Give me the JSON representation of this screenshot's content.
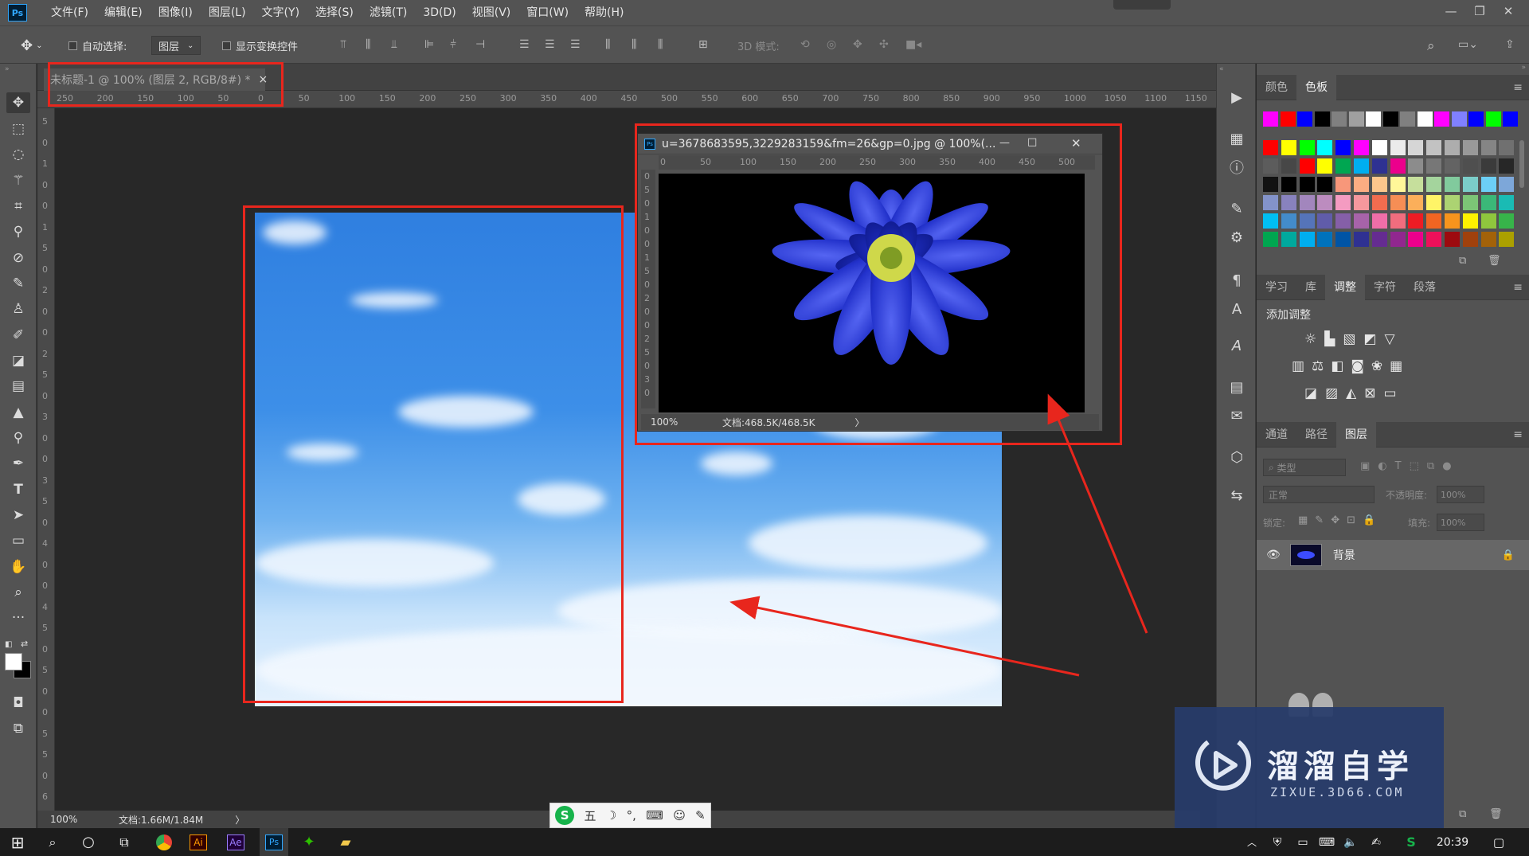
{
  "app": {
    "logo": "Ps"
  },
  "menu": [
    "文件(F)",
    "编辑(E)",
    "图像(I)",
    "图层(L)",
    "文字(Y)",
    "选择(S)",
    "滤镜(T)",
    "3D(D)",
    "视图(V)",
    "窗口(W)",
    "帮助(H)"
  ],
  "window_controls": {
    "minimize": "—",
    "restore": "❐",
    "close": "✕"
  },
  "options": {
    "auto_select_label": "自动选择:",
    "auto_select_value": "图层",
    "transform_label": "显示变换控件",
    "mode3d_label": "3D 模式:"
  },
  "tools": [
    "move-tool",
    "marquee-tool",
    "lasso-tool",
    "magic-wand-tool",
    "crop-tool",
    "eyedropper-tool",
    "healing-brush-tool",
    "brush-tool",
    "clone-stamp-tool",
    "history-brush-tool",
    "eraser-tool",
    "gradient-tool",
    "blur-tool",
    "dodge-tool",
    "pen-tool",
    "type-tool",
    "path-selection-tool",
    "rectangle-tool",
    "hand-tool",
    "zoom-tool",
    "more-tools"
  ],
  "document": {
    "tab_title": "未标题-1 @ 100% (图层 2, RGB/8#) *",
    "tab_close": "×",
    "ruler_h": [
      "250",
      "200",
      "150",
      "100",
      "50",
      "0",
      "50",
      "100",
      "150",
      "200",
      "250",
      "300",
      "350",
      "400",
      "450",
      "500",
      "550",
      "600",
      "650",
      "700",
      "750",
      "800",
      "850",
      "900",
      "950",
      "1000",
      "1050",
      "1100",
      "1150"
    ],
    "ruler_v": [
      "5",
      "0",
      "1",
      "0",
      "0",
      "1",
      "5",
      "0",
      "2",
      "0",
      "0",
      "2",
      "5",
      "0",
      "3",
      "0",
      "0",
      "3",
      "5",
      "0",
      "4",
      "0",
      "0",
      "4",
      "5",
      "0",
      "5",
      "0",
      "0",
      "5",
      "5",
      "0",
      "6"
    ]
  },
  "float_window": {
    "title": "u=3678683595,3229283159&fm=26&gp=0.jpg @ 100%(...",
    "controls": {
      "minimize": "—",
      "maximize": "□",
      "close": "✕"
    },
    "ruler_h": [
      "0",
      "50",
      "100",
      "150",
      "200",
      "250",
      "300",
      "350",
      "400",
      "450",
      "500"
    ],
    "ruler_v": [
      "0",
      "5",
      "0",
      "1",
      "0",
      "0",
      "1",
      "5",
      "0",
      "2",
      "0",
      "0",
      "2",
      "5",
      "0",
      "3",
      "0"
    ],
    "zoom": "100%",
    "doc_info": "文档:468.5K/468.5K",
    "arrow": "〉"
  },
  "panels": {
    "color_tabs": [
      "颜色",
      "色板"
    ],
    "swatches_top": [
      "#ff00ff",
      "#ff0000",
      "#0000ff",
      "#000000",
      "#808080",
      "#a0a0a0",
      "#ffffff",
      "#000000",
      "#808080",
      "#ffffff",
      "#ff00ff",
      "#8080ff",
      "#0000ff",
      "#00ff00",
      "#0000ff"
    ],
    "swatch_grid": [
      [
        "#ff0000",
        "#ffff00",
        "#00ff00",
        "#00ffff",
        "#0000ff",
        "#ff00ff",
        "#ffffff",
        "#ebebeb",
        "#d6d6d6",
        "#c2c2c2",
        "#adadad",
        "#999999",
        "#858585",
        "#707070"
      ],
      [
        "#5c5c5c",
        "#474747",
        "#ff0000",
        "#ffff00",
        "#00a651",
        "#00aeef",
        "#2e3192",
        "#ec008c",
        "#8c8c8c",
        "#777777",
        "#636363",
        "#4f4f4f",
        "#3b3b3b",
        "#272727"
      ],
      [
        "#121212",
        "#000000",
        "#000000",
        "#000000",
        "#f7977a",
        "#fbad82",
        "#fdc68c",
        "#fff799",
        "#c6df9c",
        "#a4d49d",
        "#81ca9d",
        "#7bcdc9",
        "#6ccff6",
        "#7da7d9"
      ],
      [
        "#8393ca",
        "#8882be",
        "#a286bd",
        "#bc8cbf",
        "#f49bc1",
        "#f5989d",
        "#f26c4f",
        "#f68e55",
        "#fbaf5a",
        "#fff467",
        "#acd372",
        "#7cc576",
        "#3bb878",
        "#1abbb4"
      ],
      [
        "#00bff3",
        "#438ccb",
        "#5574b9",
        "#605ca9",
        "#855fa8",
        "#a763a9",
        "#ef6ea8",
        "#f16d7e",
        "#ee1c24",
        "#f16522",
        "#f7941d",
        "#fff100",
        "#8fc63d",
        "#37b44a"
      ],
      [
        "#00a650",
        "#00a99e",
        "#00aeef",
        "#0072bc",
        "#0054a5",
        "#2f3192",
        "#652c91",
        "#91278f",
        "#ec008c",
        "#ee105a",
        "#9d0a0f",
        "#a0410d",
        "#a36209",
        "#aba000"
      ]
    ],
    "adjust_tabs": [
      "学习",
      "库",
      "调整",
      "字符",
      "段落"
    ],
    "adjust_title": "添加调整",
    "layer_tabs": [
      "通道",
      "路径",
      "图层"
    ],
    "layer_filter": "类型",
    "blend_mode": "正常",
    "opacity_label": "不透明度:",
    "opacity_value": "100%",
    "lock_label": "锁定:",
    "fill_label": "填充:",
    "fill_value": "100%",
    "layer_name": "背景"
  },
  "status": {
    "zoom": "100%",
    "doc_info": "文档:1.66M/1.84M",
    "arrow": "〉"
  },
  "ime": {
    "items": [
      "五",
      "☽",
      "°,",
      "⌨",
      "☺",
      "✎"
    ]
  },
  "watermark": {
    "title": "溜溜自学",
    "url": "ZIXUE.3D66.COM"
  },
  "taskbar": {
    "apps": [
      "Ai",
      "Ae",
      "Ps"
    ],
    "time": "20:39"
  },
  "colors": {
    "annotation": "#e8261d",
    "panel": "#535353",
    "work": "#282828"
  }
}
